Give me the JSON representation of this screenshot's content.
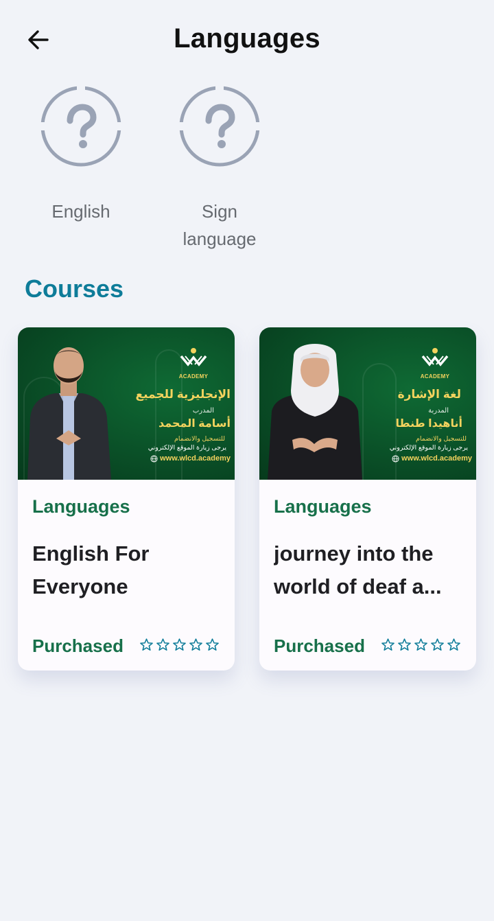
{
  "header": {
    "title": "Languages",
    "back_icon": "arrow-left-icon"
  },
  "categories": [
    {
      "label": "English",
      "icon": "question-circle-icon"
    },
    {
      "label": "Sign language",
      "icon": "question-circle-icon"
    }
  ],
  "courses_section": {
    "title": "Courses",
    "cards": [
      {
        "category": "Languages",
        "title": "English For Everyone",
        "status": "Purchased",
        "rating": 0,
        "thumbnail": {
          "logo": "ACADEMY",
          "arabic_title": "الإنجليزية للجميع",
          "role": "المدرب",
          "name": "أسامة المحمد",
          "line1": "للتسجيل والانضمام",
          "line2": "يرجى زيارة الموقع الإلكتروني",
          "website": "www.wlcd.academy"
        }
      },
      {
        "category": "Languages",
        "title": "journey into the world of deaf a...",
        "status": "Purchased",
        "rating": 0,
        "thumbnail": {
          "logo": "ACADEMY",
          "arabic_title": "لغة الإشارة",
          "role": "المدربة",
          "name": "أناهيدا طنطا",
          "line1": "للتسجيل والانضمام",
          "line2": "يرجى زيارة الموقع الإلكتروني",
          "website": "www.wlcd.academy"
        }
      }
    ]
  },
  "colors": {
    "background": "#f1f3f8",
    "accent_teal": "#0e7c99",
    "green": "#17704a",
    "thumbnail_green": "#0a4f27",
    "gold": "#f4d35e",
    "icon_gray": "#9aa3b5"
  }
}
